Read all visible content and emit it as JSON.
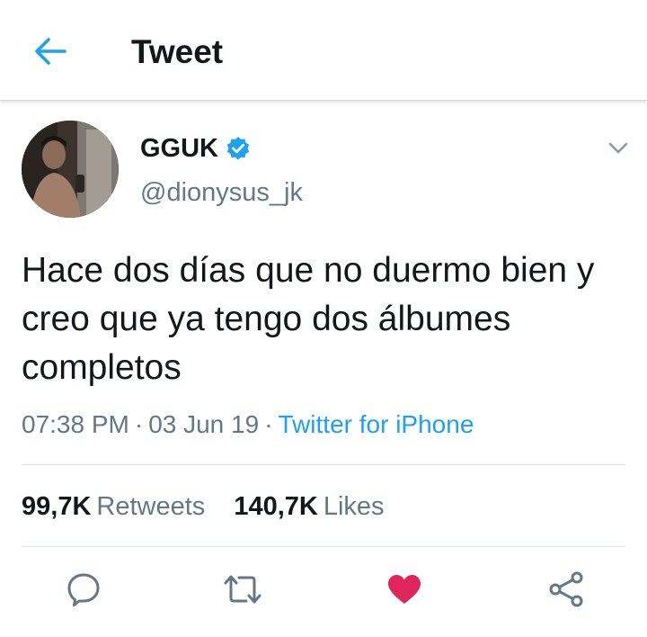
{
  "header": {
    "back_icon": "arrow-left-icon",
    "title": "Tweet"
  },
  "tweet": {
    "author": {
      "display_name": "GGUK",
      "handle": "@dionysus_jk",
      "verified": true
    },
    "text": "Hace dos días que no duermo bien y creo que ya tengo dos álbumes completos",
    "time": "07:38 PM",
    "date": "03 Jun 19",
    "separator": "·",
    "source": "Twitter for iPhone",
    "stats": {
      "retweets_count": "99,7K",
      "retweets_label": "Retweets",
      "likes_count": "140,7K",
      "likes_label": "Likes"
    }
  },
  "actions": [
    {
      "name": "reply",
      "icon": "speech-bubble-icon"
    },
    {
      "name": "retweet",
      "icon": "retweet-icon"
    },
    {
      "name": "like",
      "icon": "heart-icon",
      "active": true
    },
    {
      "name": "share",
      "icon": "share-icon"
    }
  ],
  "colors": {
    "accent": "#1da1f2",
    "secondary_text": "#657786",
    "primary_text": "#14171a",
    "like_active": "#e0245e",
    "divider": "#e1e8ed"
  }
}
